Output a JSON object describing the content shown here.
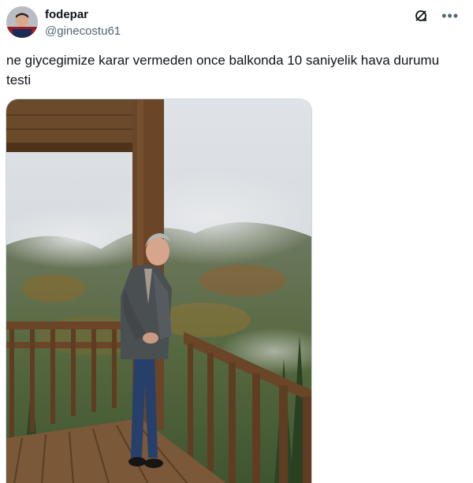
{
  "tweet": {
    "display_name": "fodepar",
    "handle": "@ginecostu61",
    "text": "ne giycegimize karar vermeden once balkonda 10 saniyelik hava durumu testi"
  },
  "icons": {
    "grok": "grok-icon",
    "more": "more-icon"
  },
  "colors": {
    "text_primary": "#0f1419",
    "text_secondary": "#536471",
    "border": "#cfd9de"
  }
}
